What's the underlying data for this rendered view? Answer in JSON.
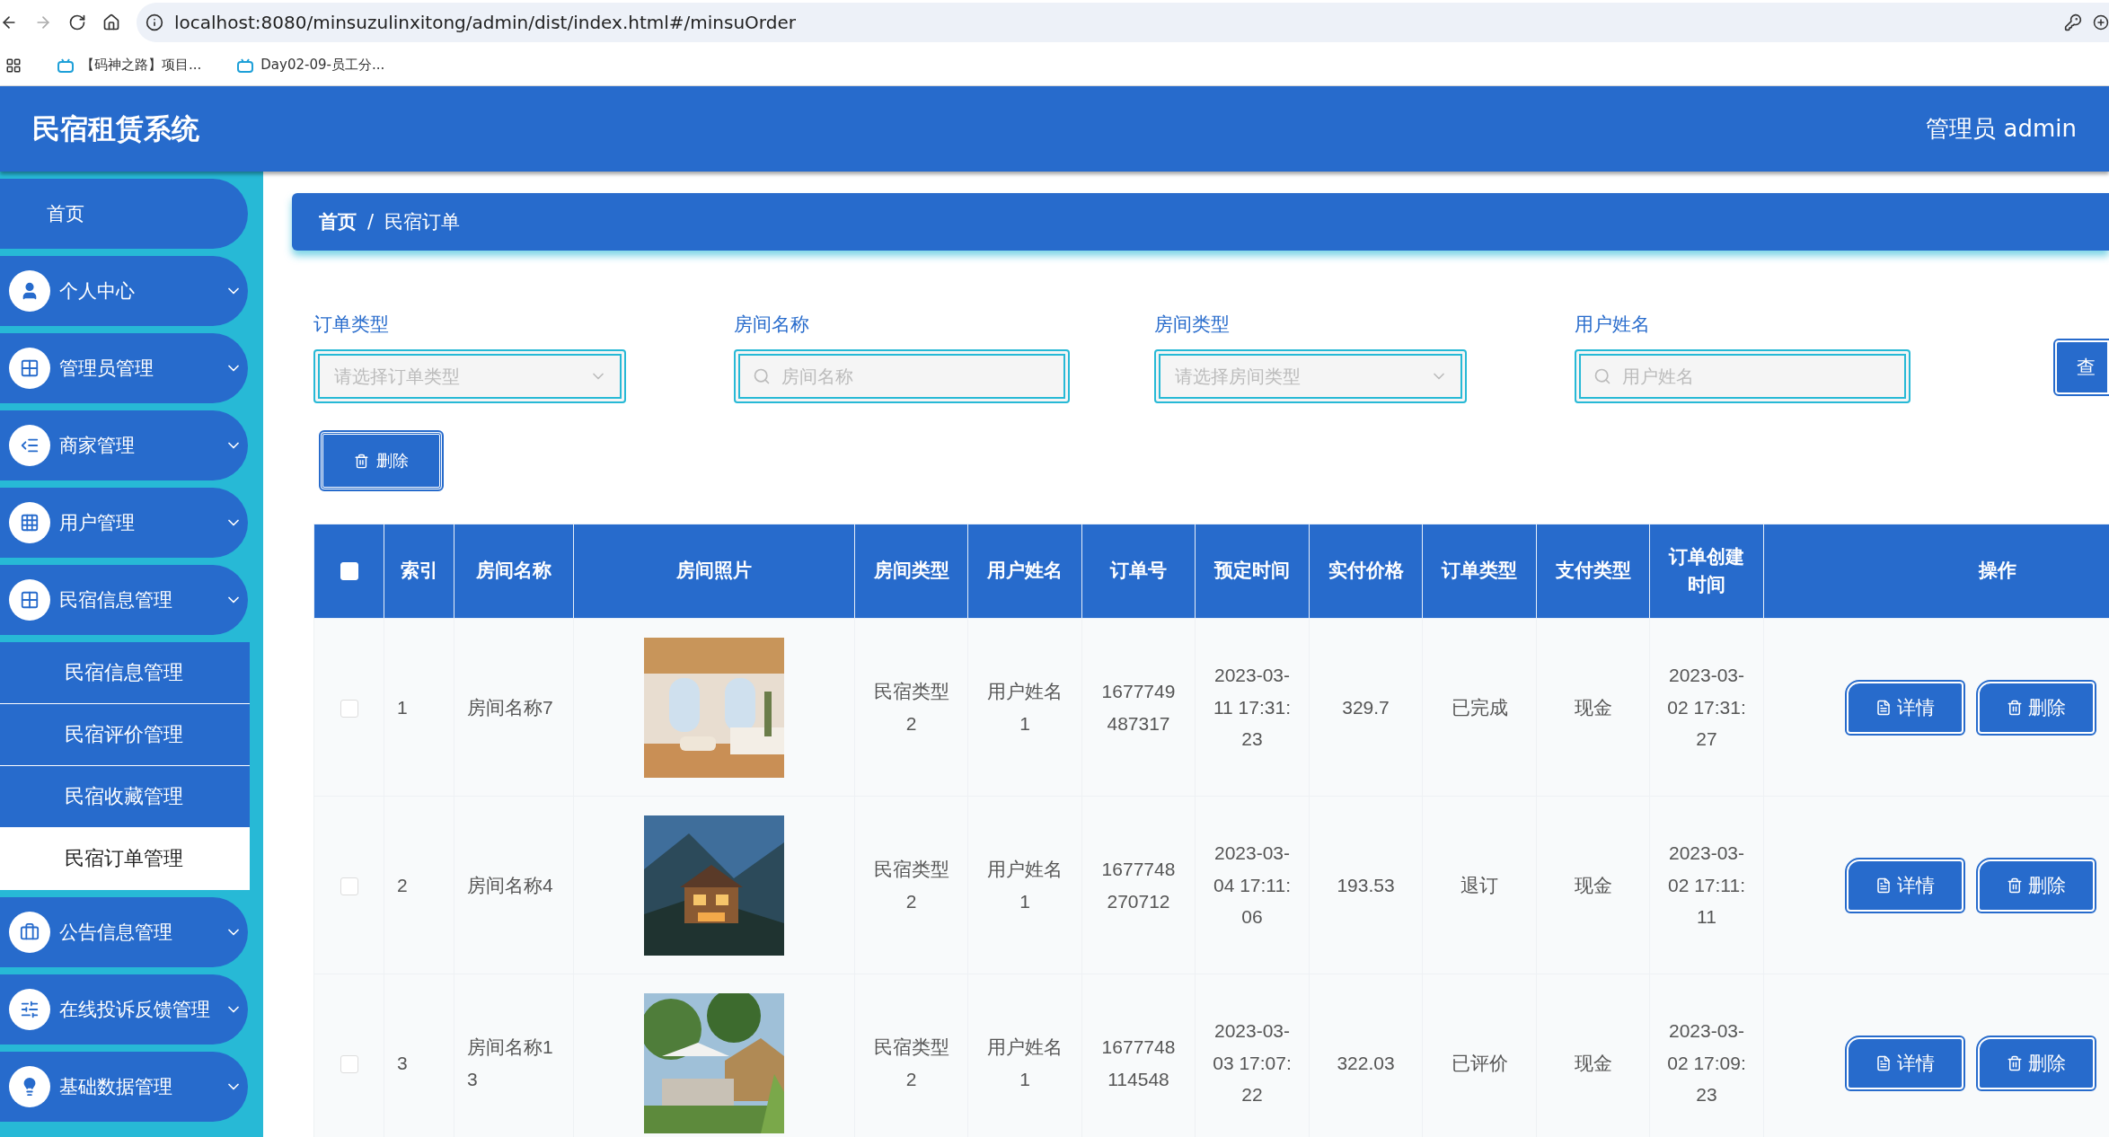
{
  "browser": {
    "url": "localhost:8080/minsuzulinxitong/admin/dist/index.html#/minsuOrder",
    "bookmarks": [
      "【码神之路】项目...",
      "Day02-09-员工分..."
    ]
  },
  "header": {
    "title": "民宿租赁系统",
    "user": "管理员 admin"
  },
  "sidebar": {
    "items": [
      {
        "label": "首页"
      },
      {
        "label": "个人中心"
      },
      {
        "label": "管理员管理"
      },
      {
        "label": "商家管理"
      },
      {
        "label": "用户管理"
      },
      {
        "label": "民宿信息管理",
        "children": [
          {
            "label": "民宿信息管理",
            "selected": false
          },
          {
            "label": "民宿评价管理",
            "selected": false
          },
          {
            "label": "民宿收藏管理",
            "selected": false
          },
          {
            "label": "民宿订单管理",
            "selected": true
          }
        ]
      },
      {
        "label": "公告信息管理"
      },
      {
        "label": "在线投诉反馈管理"
      },
      {
        "label": "基础数据管理"
      }
    ]
  },
  "breadcrumb": [
    "首页",
    "/",
    "民宿订单"
  ],
  "filters": [
    {
      "kind": "select",
      "label": "订单类型",
      "placeholder": "请选择订单类型"
    },
    {
      "kind": "search",
      "label": "房间名称",
      "placeholder": "房间名称"
    },
    {
      "kind": "select",
      "label": "房间类型",
      "placeholder": "请选择房间类型"
    },
    {
      "kind": "search",
      "label": "用户姓名",
      "placeholder": "用户姓名"
    }
  ],
  "query_button": "查",
  "delete_button": "删除",
  "table": {
    "select_all_checked": false,
    "columns": [
      "索引",
      "房间名称",
      "房间照片",
      "房间类型",
      "用户姓名",
      "订单号",
      "预定时间",
      "实付价格",
      "订单类型",
      "支付类型",
      "订单创建时间",
      "操作"
    ],
    "rows": [
      {
        "checked": false,
        "index": "1",
        "room_name": "房间名称7",
        "photo": {
          "kind": "picture"
        },
        "room_type": "民宿类型2",
        "user_name": "用户姓名1",
        "order_no": "1677749487317",
        "booking_time": "2023-03-11 17:31:23",
        "price": "329.7",
        "order_type": "已完成",
        "pay_type": "现金",
        "created": "2023-03-02 17:31:27",
        "actions": [
          "详情",
          "删除"
        ]
      },
      {
        "checked": false,
        "index": "2",
        "room_name": "房间名称4",
        "photo": {
          "kind": "picture"
        },
        "room_type": "民宿类型2",
        "user_name": "用户姓名1",
        "order_no": "1677748270712",
        "booking_time": "2023-03-04 17:11:06",
        "price": "193.53",
        "order_type": "退订",
        "pay_type": "现金",
        "created": "2023-03-02 17:11:11",
        "actions": [
          "详情",
          "删除"
        ]
      },
      {
        "checked": false,
        "index": "3",
        "room_name": "房间名称13",
        "photo": {
          "kind": "picture"
        },
        "room_type": "民宿类型2",
        "user_name": "用户姓名1",
        "order_no": "1677748114548",
        "booking_time": "2023-03-03 17:07:22",
        "price": "322.03",
        "order_type": "已评价",
        "pay_type": "现金",
        "created": "2023-03-02 17:09:23",
        "actions": [
          "详情",
          "删除"
        ]
      }
    ]
  }
}
